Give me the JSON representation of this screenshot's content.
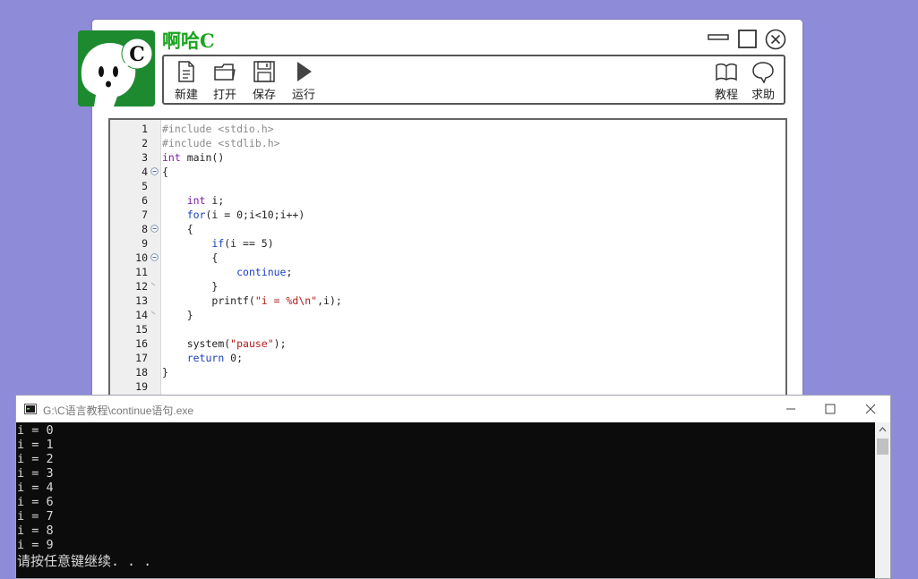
{
  "app": {
    "title": "啊哈C",
    "logo_letter": "C",
    "colors": {
      "background": "#8e8bd9",
      "title_green": "#19a61f",
      "logo_green": "#1d8a2f"
    }
  },
  "toolbar": {
    "new_label": "新建",
    "open_label": "打开",
    "save_label": "保存",
    "run_label": "运行",
    "tutorial_label": "教程",
    "help_label": "求助"
  },
  "editor": {
    "lines": [
      {
        "n": "1",
        "indent": "",
        "tokens": [
          {
            "t": "#include <stdio.h>",
            "c": "pp"
          }
        ]
      },
      {
        "n": "2",
        "indent": "",
        "tokens": [
          {
            "t": "#include <stdlib.h>",
            "c": "pp"
          }
        ]
      },
      {
        "n": "3",
        "indent": "",
        "tokens": [
          {
            "t": "int",
            "c": "kw"
          },
          {
            "t": " main()",
            "c": ""
          }
        ]
      },
      {
        "n": "4",
        "indent": "",
        "fold": "open",
        "tokens": [
          {
            "t": "{",
            "c": ""
          }
        ]
      },
      {
        "n": "5",
        "indent": "",
        "tokens": []
      },
      {
        "n": "6",
        "indent": "    ",
        "tokens": [
          {
            "t": "int",
            "c": "kw"
          },
          {
            "t": " i;",
            "c": ""
          }
        ]
      },
      {
        "n": "7",
        "indent": "    ",
        "tokens": [
          {
            "t": "for",
            "c": "kw2"
          },
          {
            "t": "(i = 0;i<10;i++)",
            "c": ""
          }
        ]
      },
      {
        "n": "8",
        "indent": "    ",
        "fold": "open",
        "tokens": [
          {
            "t": "{",
            "c": ""
          }
        ]
      },
      {
        "n": "9",
        "indent": "        ",
        "tokens": [
          {
            "t": "if",
            "c": "kw2"
          },
          {
            "t": "(i == 5)",
            "c": ""
          }
        ]
      },
      {
        "n": "10",
        "indent": "        ",
        "fold": "open",
        "tokens": [
          {
            "t": "{",
            "c": ""
          }
        ]
      },
      {
        "n": "11",
        "indent": "            ",
        "tokens": [
          {
            "t": "continue",
            "c": "kw2"
          },
          {
            "t": ";",
            "c": ""
          }
        ]
      },
      {
        "n": "12",
        "indent": "        ",
        "fold": "end",
        "tokens": [
          {
            "t": "}",
            "c": ""
          }
        ]
      },
      {
        "n": "13",
        "indent": "        ",
        "tokens": [
          {
            "t": "printf(",
            "c": ""
          },
          {
            "t": "\"i = %d\\n\"",
            "c": "str"
          },
          {
            "t": ",i);",
            "c": ""
          }
        ]
      },
      {
        "n": "14",
        "indent": "    ",
        "fold": "end",
        "tokens": [
          {
            "t": "}",
            "c": ""
          }
        ]
      },
      {
        "n": "15",
        "indent": "",
        "tokens": []
      },
      {
        "n": "16",
        "indent": "    ",
        "tokens": [
          {
            "t": "system(",
            "c": ""
          },
          {
            "t": "\"pause\"",
            "c": "str"
          },
          {
            "t": ");",
            "c": ""
          }
        ]
      },
      {
        "n": "17",
        "indent": "    ",
        "tokens": [
          {
            "t": "return",
            "c": "kw2"
          },
          {
            "t": " 0;",
            "c": ""
          }
        ]
      },
      {
        "n": "18",
        "indent": "",
        "tokens": [
          {
            "t": "}",
            "c": ""
          }
        ]
      },
      {
        "n": "19",
        "indent": "",
        "tokens": []
      }
    ]
  },
  "console": {
    "title": "G:\\C语言教程\\continue语句.exe",
    "output": [
      "i = 0",
      "i = 1",
      "i = 2",
      "i = 3",
      "i = 4",
      "i = 6",
      "i = 7",
      "i = 8",
      "i = 9"
    ],
    "prompt": "请按任意键继续. . ."
  }
}
